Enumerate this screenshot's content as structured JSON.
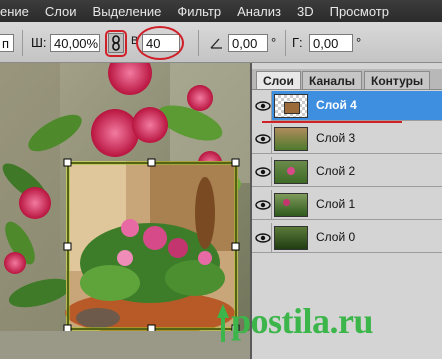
{
  "menu": {
    "items": [
      "ение",
      "Слои",
      "Выделение",
      "Фильтр",
      "Анализ",
      "3D",
      "Просмотр"
    ]
  },
  "options": {
    "left_fragment": "п",
    "width_label": "Ш:",
    "width_value": "40,00%",
    "link_icon": "chain-link-icon",
    "height_value": "40",
    "angle_value": "0,00",
    "angle_unit": "°",
    "skew_label": "Г:",
    "skew_value": "0,00"
  },
  "layers_panel": {
    "tabs": [
      "Слои",
      "Каналы",
      "Контуры"
    ],
    "active_tab": "Слои",
    "layers": [
      {
        "name": "Слой 4",
        "selected": true
      },
      {
        "name": "Слой 3",
        "selected": false
      },
      {
        "name": "Слой 2",
        "selected": false
      },
      {
        "name": "Слой 1",
        "selected": false
      },
      {
        "name": "Слой 0",
        "selected": false
      }
    ]
  },
  "watermark": "postila.ru",
  "colors": {
    "accent_red": "#d0202a",
    "selection_blue": "#3f8fe0",
    "watermark_green": "#3cb54a"
  }
}
